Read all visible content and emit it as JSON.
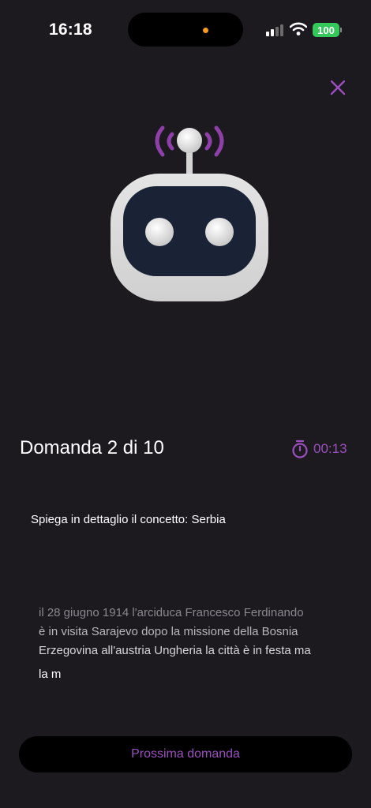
{
  "status_bar": {
    "time": "16:18",
    "battery": "100",
    "battery_color": "#34c759",
    "privacy_dot_color": "#f59a23"
  },
  "accent_color": "#9b4fbf",
  "icons": {
    "close": "close-icon",
    "robot": "robot-icon",
    "timer": "stopwatch-icon"
  },
  "quiz": {
    "counter": "Domanda 2 di 10",
    "timer": "00:13",
    "prompt": "Spiega in dettaglio il concetto: Serbia",
    "answer_lines": [
      "il 28 giugno 1914 l'arciduca Francesco Ferdinando",
      "è in visita Sarajevo dopo la missione della Bosnia",
      "Erzegovina all'austria Ungheria la città è in festa ma"
    ],
    "answer_last_line": "la m",
    "next_button": "Prossima domanda"
  }
}
